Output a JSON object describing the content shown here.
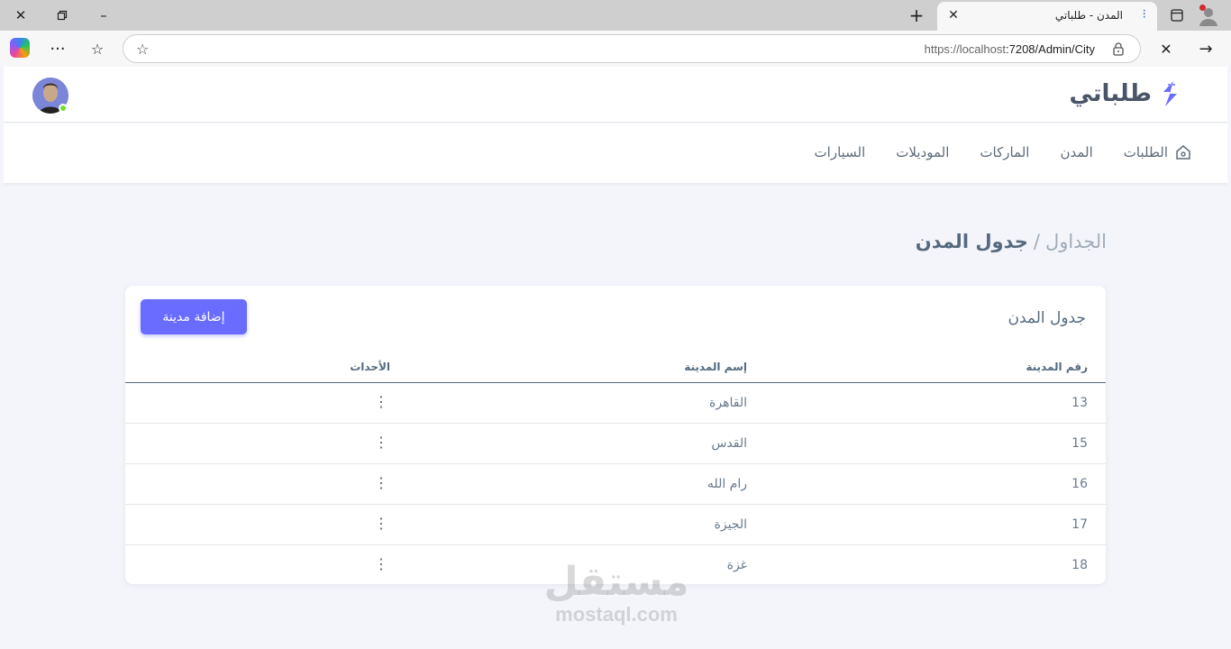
{
  "browser": {
    "tab_title": "المدن - طلباتي",
    "url_host": "https://localhost",
    "url_path": ":7208/Admin/City"
  },
  "app": {
    "brand": "طلباتي",
    "colors": {
      "accent": "#696cff",
      "online": "#71dd37"
    }
  },
  "menu": {
    "items": [
      {
        "label": "الطلبات",
        "icon": "home-icon"
      },
      {
        "label": "المدن"
      },
      {
        "label": "الماركات"
      },
      {
        "label": "الموديلات"
      },
      {
        "label": "السيارات"
      }
    ]
  },
  "breadcrumb": {
    "parent": "الجداول",
    "separator": "/",
    "current": "جدول المدن"
  },
  "card": {
    "title": "جدول المدن",
    "add_button": "إضافة مدينة",
    "columns": [
      "رقم المدينة",
      "إسم المدينة",
      "الأحداث"
    ],
    "rows": [
      {
        "id": "13",
        "name": "القاهرة",
        "actions": "⋮"
      },
      {
        "id": "15",
        "name": "القدس",
        "actions": "⋮"
      },
      {
        "id": "16",
        "name": "رام الله",
        "actions": "⋮"
      },
      {
        "id": "17",
        "name": "الجيزة",
        "actions": "⋮"
      },
      {
        "id": "18",
        "name": "غزة",
        "actions": "⋮"
      }
    ]
  },
  "watermark": {
    "arabic": "مستقل",
    "latin": "mostaql.com"
  }
}
